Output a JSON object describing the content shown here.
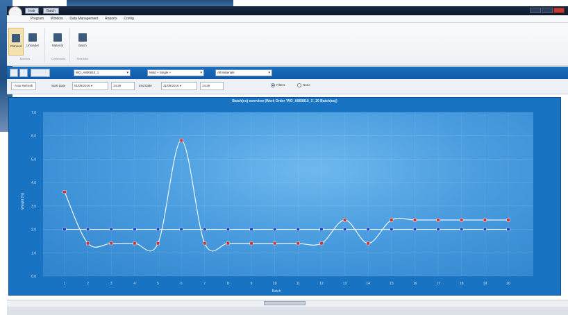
{
  "window": {
    "title": "",
    "tabs": [
      "Instr",
      "Batch"
    ]
  },
  "menu": [
    "Program",
    "Window",
    "Data Management",
    "Reports",
    "Config"
  ],
  "ribbon": {
    "buttons": [
      "Planned",
      "Unloader",
      "Material",
      "Batch"
    ],
    "groups": [
      "Batches",
      "Continuous",
      "Simulator"
    ]
  },
  "toolbar": {
    "order_select": "WO_A800810_1",
    "mold_select": "Mold + Single +",
    "view_select": "All Materials"
  },
  "filters": {
    "auto_refresh": "Auto Refresh",
    "start_label": "Start Date",
    "start_date": "01/09/2016",
    "start_time": "14:26",
    "end_label": "End Date",
    "end_date": "21/09/2016",
    "end_time": "14:26",
    "radio_filters": "Filters",
    "radio_none": "None"
  },
  "chart_data": {
    "type": "line",
    "title": "Batch(es) overview (Work Order 'WO_A800810_1', 20 Batch(es))",
    "xlabel": "Batch",
    "ylabel": "Weight [%]",
    "categories": [
      "1",
      "2",
      "3",
      "4",
      "5",
      "6",
      "7",
      "8",
      "9",
      "10",
      "11",
      "12",
      "13",
      "14",
      "15",
      "16",
      "17",
      "18",
      "19",
      "20"
    ],
    "ylim": [
      0,
      7
    ],
    "y_ticks": [
      "0.0",
      "1.0",
      "2.0",
      "3.0",
      "4.0",
      "5.0",
      "6.0",
      "7.0"
    ],
    "series": [
      {
        "values": [
          3.6,
          1.4,
          1.4,
          1.4,
          1.4,
          5.8,
          1.4,
          1.4,
          1.4,
          1.4,
          1.4,
          1.4,
          2.4,
          1.4,
          2.4,
          2.4,
          2.4,
          2.4,
          2.4,
          2.4
        ],
        "color": "#ffffff",
        "marker_color": "#d9302b"
      },
      {
        "values": [
          2.0,
          2.0,
          2.0,
          2.0,
          2.0,
          2.0,
          2.0,
          2.0,
          2.0,
          2.0,
          2.0,
          2.0,
          2.0,
          2.0,
          2.0,
          2.0,
          2.0,
          2.0,
          2.0,
          2.0
        ],
        "color": "#ffffff",
        "marker_color": "#1f3fd1"
      }
    ],
    "grid": true
  }
}
